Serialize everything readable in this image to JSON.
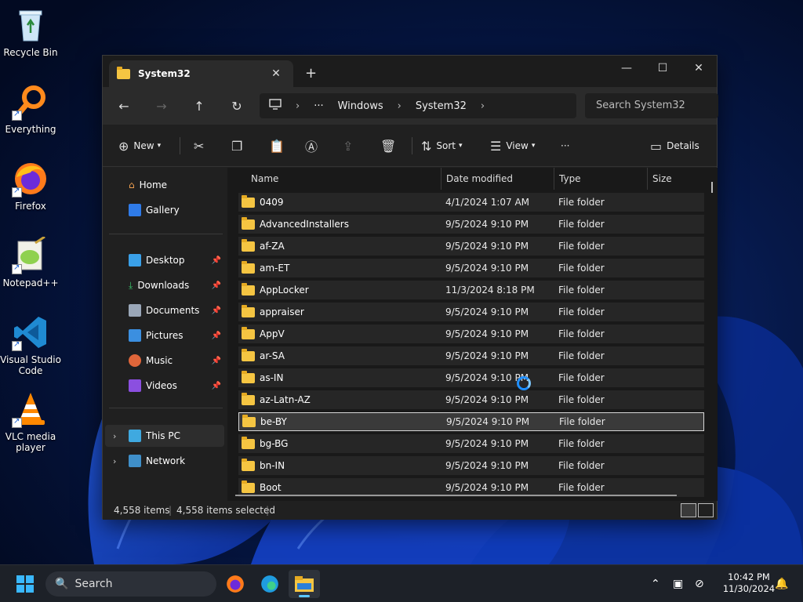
{
  "desktop": {
    "icons": [
      {
        "label": "Recycle Bin"
      },
      {
        "label": "Everything"
      },
      {
        "label": "Firefox"
      },
      {
        "label": "Notepad++"
      },
      {
        "label": "Visual Studio Code"
      },
      {
        "label": "VLC media player"
      }
    ]
  },
  "window": {
    "tab_title": "System32",
    "tab_close": "✕",
    "new_tab": "+",
    "controls": {
      "minimize": "—",
      "maximize": "☐",
      "close": "✕"
    },
    "breadcrumb": {
      "overflow": "···",
      "items": [
        "Windows",
        "System32"
      ]
    },
    "search_placeholder": "Search System32",
    "toolbar": {
      "new_label": "New",
      "sort_label": "Sort",
      "view_label": "View",
      "more_label": "···",
      "details_label": "Details"
    },
    "sidebar": {
      "items": [
        {
          "label": "Home"
        },
        {
          "label": "Gallery"
        },
        {
          "label": "Desktop"
        },
        {
          "label": "Downloads"
        },
        {
          "label": "Documents"
        },
        {
          "label": "Pictures"
        },
        {
          "label": "Music"
        },
        {
          "label": "Videos"
        },
        {
          "label": "This PC"
        },
        {
          "label": "Network"
        }
      ]
    },
    "columns": [
      "Name",
      "Date modified",
      "Type",
      "Size"
    ],
    "files": [
      {
        "name": "0409",
        "date": "4/1/2024 1:07 AM",
        "type": "File folder"
      },
      {
        "name": "AdvancedInstallers",
        "date": "9/5/2024 9:10 PM",
        "type": "File folder"
      },
      {
        "name": "af-ZA",
        "date": "9/5/2024 9:10 PM",
        "type": "File folder"
      },
      {
        "name": "am-ET",
        "date": "9/5/2024 9:10 PM",
        "type": "File folder"
      },
      {
        "name": "AppLocker",
        "date": "11/3/2024 8:18 PM",
        "type": "File folder"
      },
      {
        "name": "appraiser",
        "date": "9/5/2024 9:10 PM",
        "type": "File folder"
      },
      {
        "name": "AppV",
        "date": "9/5/2024 9:10 PM",
        "type": "File folder"
      },
      {
        "name": "ar-SA",
        "date": "9/5/2024 9:10 PM",
        "type": "File folder"
      },
      {
        "name": "as-IN",
        "date": "9/5/2024 9:10 PM",
        "type": "File folder"
      },
      {
        "name": "az-Latn-AZ",
        "date": "9/5/2024 9:10 PM",
        "type": "File folder"
      },
      {
        "name": "be-BY",
        "date": "9/5/2024 9:10 PM",
        "type": "File folder"
      },
      {
        "name": "bg-BG",
        "date": "9/5/2024 9:10 PM",
        "type": "File folder"
      },
      {
        "name": "bn-IN",
        "date": "9/5/2024 9:10 PM",
        "type": "File folder"
      },
      {
        "name": "Boot",
        "date": "9/5/2024 9:10 PM",
        "type": "File folder"
      }
    ],
    "status": {
      "item_count": "4,558 items",
      "selected": "4,558 items selected"
    }
  },
  "taskbar": {
    "search_label": "Search",
    "time": "10:42 PM",
    "date": "11/30/2024"
  }
}
